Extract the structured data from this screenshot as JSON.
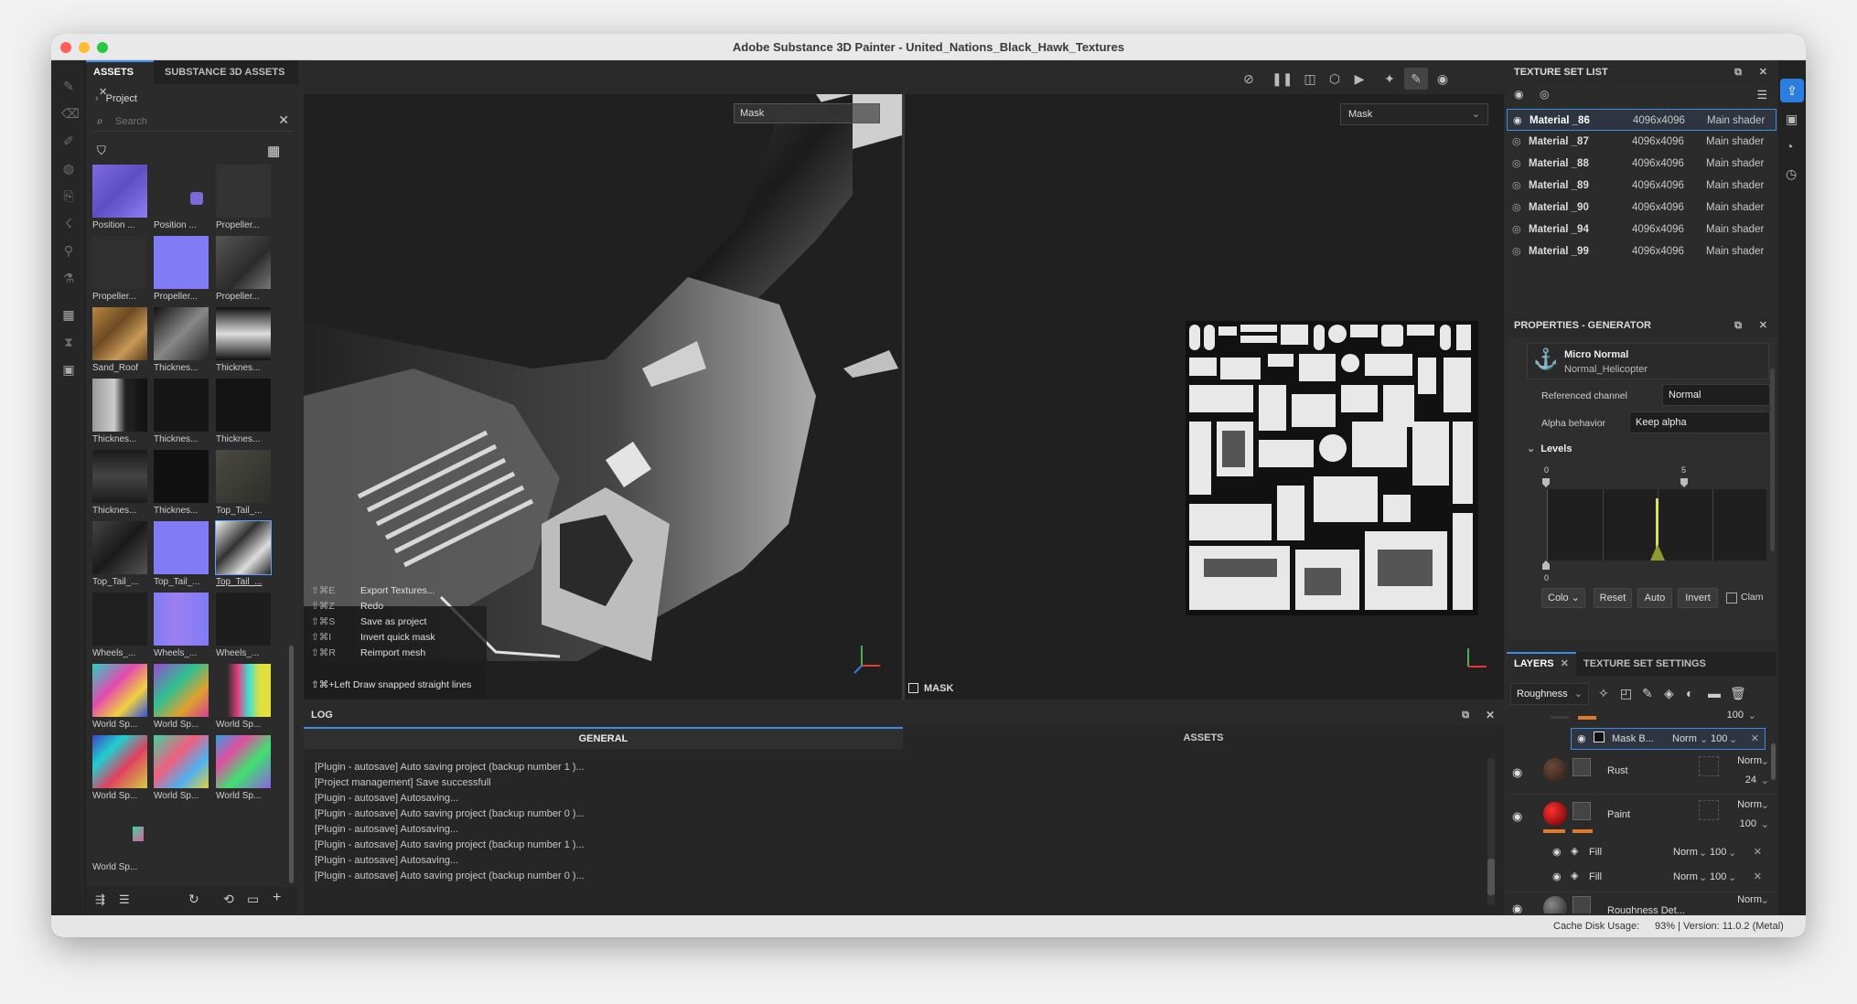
{
  "window": {
    "title": "Adobe Substance 3D Painter - United_Nations_Black_Hawk_Textures"
  },
  "assets": {
    "tabs": [
      "ASSETS",
      "SUBSTANCE 3D ASSETS"
    ],
    "breadcrumb": "Project",
    "search_placeholder": "Search",
    "items": [
      {
        "label": "Position ..."
      },
      {
        "label": "Position ..."
      },
      {
        "label": "Propeller..."
      },
      {
        "label": "Propeller..."
      },
      {
        "label": "Propeller..."
      },
      {
        "label": "Propeller..."
      },
      {
        "label": "Sand_Roof"
      },
      {
        "label": "Thicknes..."
      },
      {
        "label": "Thicknes..."
      },
      {
        "label": "Thicknes..."
      },
      {
        "label": "Thicknes..."
      },
      {
        "label": "Thicknes..."
      },
      {
        "label": "Thicknes..."
      },
      {
        "label": "Thicknes..."
      },
      {
        "label": "Top_Tail_..."
      },
      {
        "label": "Top_Tail_..."
      },
      {
        "label": "Top_Tail_..."
      },
      {
        "label": "Top_Tail_..."
      },
      {
        "label": "Wheels_..."
      },
      {
        "label": "Wheels_..."
      },
      {
        "label": "Wheels_..."
      },
      {
        "label": "World Sp..."
      },
      {
        "label": "World Sp..."
      },
      {
        "label": "World Sp..."
      },
      {
        "label": "World Sp..."
      },
      {
        "label": "World Sp..."
      },
      {
        "label": "World Sp..."
      },
      {
        "label": "World Sp..."
      }
    ]
  },
  "viewport": {
    "left_dropdown": "Mask",
    "right_dropdown": "Mask",
    "mask_label": "MASK",
    "shortcuts": [
      {
        "key": "⇧⌘E",
        "action": "Export Textures..."
      },
      {
        "key": "⇧⌘Z",
        "action": "Redo"
      },
      {
        "key": "⇧⌘S",
        "action": "Save as project"
      },
      {
        "key": "⇧⌘I",
        "action": "Invert quick mask"
      },
      {
        "key": "⇧⌘R",
        "action": "Reimport mesh"
      }
    ],
    "hint": "⇧⌘+Left  Draw snapped straight lines"
  },
  "log": {
    "title": "LOG",
    "tabs": [
      "GENERAL",
      "ASSETS"
    ],
    "lines": [
      "[Plugin - autosave] Auto saving project (backup number 1 )...",
      "[Project management] Save successfull",
      "[Plugin - autosave] Autosaving...",
      "[Plugin - autosave] Auto saving project (backup number 0 )...",
      "[Plugin - autosave] Autosaving...",
      "[Plugin - autosave] Auto saving project (backup number 1 )...",
      "[Plugin - autosave] Autosaving...",
      "[Plugin - autosave] Auto saving project (backup number 0 )..."
    ]
  },
  "texture_set_list": {
    "title": "TEXTURE SET LIST",
    "rows": [
      {
        "name": "Material _86",
        "res": "4096x4096",
        "shader": "Main shader"
      },
      {
        "name": "Material _87",
        "res": "4096x4096",
        "shader": "Main shader"
      },
      {
        "name": "Material _88",
        "res": "4096x4096",
        "shader": "Main shader"
      },
      {
        "name": "Material _89",
        "res": "4096x4096",
        "shader": "Main shader"
      },
      {
        "name": "Material _90",
        "res": "4096x4096",
        "shader": "Main shader"
      },
      {
        "name": "Material _94",
        "res": "4096x4096",
        "shader": "Main shader"
      },
      {
        "name": "Material _99",
        "res": "4096x4096",
        "shader": "Main shader"
      }
    ]
  },
  "properties": {
    "title": "PROPERTIES - GENERATOR",
    "resource_name": "Micro Normal",
    "resource_sub": "Normal_Helicopter",
    "ref_channel_label": "Referenced channel",
    "ref_channel_value": "Normal",
    "alpha_label": "Alpha behavior",
    "alpha_value": "Keep alpha",
    "levels_label": "Levels",
    "levels_top_left": "0",
    "levels_top_right": "5",
    "levels_bottom": "0",
    "buttons": {
      "color": "Colo",
      "reset": "Reset",
      "auto": "Auto",
      "invert": "Invert",
      "clamp": "Clam"
    }
  },
  "layers": {
    "tabs": [
      "LAYERS",
      "TEXTURE SET SETTINGS"
    ],
    "channel": "Roughness",
    "rows": [
      {
        "name": "",
        "blend": "",
        "opacity": "100"
      },
      {
        "name": "Mask B...",
        "blend": "Norm",
        "opacity": "100"
      },
      {
        "name": "Rust",
        "blend": "Norm",
        "opacity": "24"
      },
      {
        "name": "Paint",
        "blend": "Norm",
        "opacity": "100"
      },
      {
        "name": "Fill",
        "blend": "Norm",
        "opacity": "100"
      },
      {
        "name": "Fill",
        "blend": "Norm",
        "opacity": "100"
      },
      {
        "name": "Roughness Det...",
        "blend": "Norm",
        "opacity": ""
      }
    ]
  },
  "status": {
    "cache": "Cache Disk Usage:",
    "usage": "93% | Version: 11.0.2 (Metal)"
  }
}
